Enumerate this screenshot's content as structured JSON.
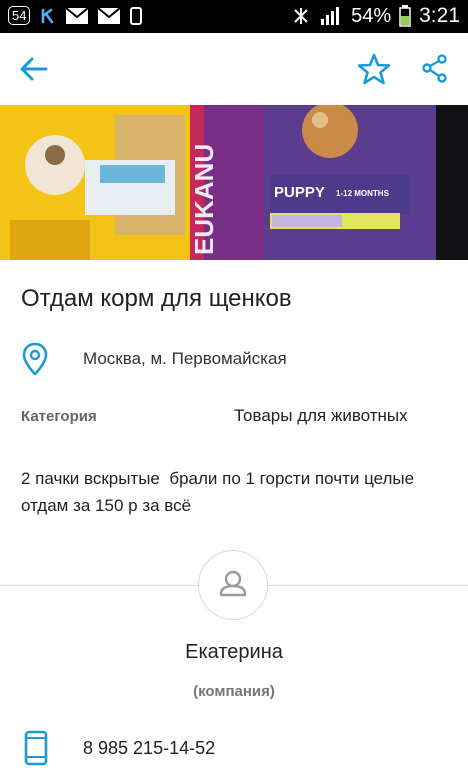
{
  "status_bar": {
    "notification_badge": "54",
    "battery": "54%",
    "time": "3:21"
  },
  "toolbar": {
    "back_icon": "back-arrow-icon",
    "favorite_icon": "star-icon",
    "share_icon": "share-icon",
    "accent_color": "#1a9bd7"
  },
  "hero": {
    "bag_text": "EUKANU",
    "puppy_label": "PUPPY",
    "months_label": "1-12 MONTHS"
  },
  "listing": {
    "title": "Отдам корм для щенков",
    "location": "Москва, м. Первомайская",
    "category_label": "Категория",
    "category_value": "Товары для животных",
    "description_line1": "2 пачки вскрытые  брали по 1 горсти почти целые",
    "description_line2": "отдам за 150 р за всё"
  },
  "seller": {
    "name": "Екатерина",
    "type": "(компания)",
    "phone": "8 985 215-14-52"
  }
}
